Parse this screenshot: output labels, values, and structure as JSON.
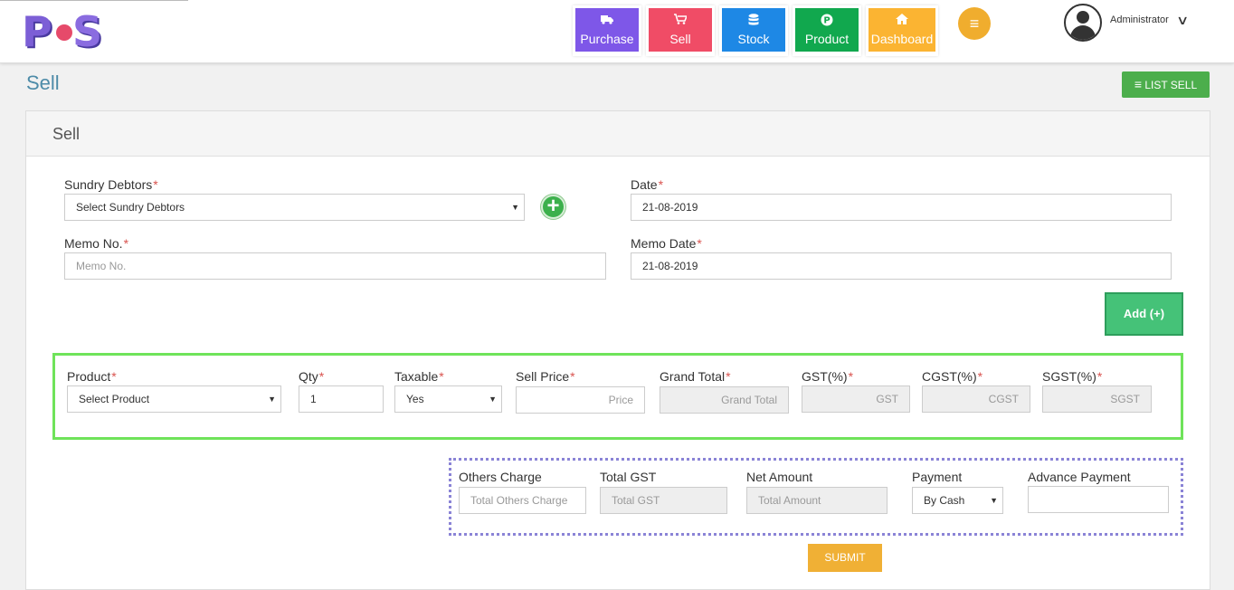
{
  "brand": {
    "logo_letter_1": "P",
    "logo_letter_2": "S",
    "colors": {
      "purple": "#7c5fd6",
      "pink": "#e64a6a"
    }
  },
  "nav": {
    "purchase": {
      "label": "Purchase",
      "icon": "truck-icon",
      "color": "#7e57e8"
    },
    "sell": {
      "label": "Sell",
      "icon": "cart-icon",
      "color": "#f04c66"
    },
    "stock": {
      "label": "Stock",
      "icon": "database-icon",
      "color": "#1e88e5"
    },
    "product": {
      "label": "Product",
      "icon": "product-p-icon",
      "color": "#11a84e"
    },
    "dashboard": {
      "label": "Dashboard",
      "icon": "home-icon",
      "color": "#fbb432"
    },
    "menu_icon": "hamburger-icon"
  },
  "user": {
    "name": "Administrator"
  },
  "page": {
    "title": "Sell",
    "list_button": "LIST SELL"
  },
  "panel": {
    "title": "Sell"
  },
  "form": {
    "sundry_debtors": {
      "label": "Sundry Debtors",
      "value": "Select Sundry Debtors"
    },
    "date": {
      "label": "Date",
      "value": "21-08-2019"
    },
    "memo_no": {
      "label": "Memo No.",
      "placeholder": "Memo No."
    },
    "memo_date": {
      "label": "Memo Date",
      "value": "21-08-2019"
    },
    "add_button": "Add (+)",
    "required_mark": "*"
  },
  "product_row": {
    "product": {
      "label": "Product",
      "value": "Select Product"
    },
    "qty": {
      "label": "Qty",
      "value": "1"
    },
    "taxable": {
      "label": "Taxable",
      "value": "Yes"
    },
    "sell_price": {
      "label": "Sell Price",
      "placeholder": "Price"
    },
    "grand_total": {
      "label": "Grand Total",
      "placeholder": "Grand Total"
    },
    "gst": {
      "label": "GST(%)",
      "placeholder": "GST"
    },
    "cgst": {
      "label": "CGST(%)",
      "placeholder": "CGST"
    },
    "sgst": {
      "label": "SGST(%)",
      "placeholder": "SGST"
    }
  },
  "totals": {
    "others_charge": {
      "label": "Others Charge",
      "placeholder": "Total Others Charge"
    },
    "total_gst": {
      "label": "Total GST",
      "placeholder": "Total GST"
    },
    "net_amount": {
      "label": "Net Amount",
      "placeholder": "Total Amount"
    },
    "payment": {
      "label": "Payment",
      "value": "By Cash"
    },
    "advance_payment": {
      "label": "Advance Payment",
      "placeholder": ""
    }
  },
  "submit_label": "SUBMIT",
  "glyphs": {
    "caret": "▼",
    "plus": "+",
    "menu": "≡",
    "list": "≡",
    "chevron": "∨",
    "truck": "■",
    "cart": "▀",
    "db": "≋",
    "p": "Ⓟ",
    "home": "⌂"
  }
}
